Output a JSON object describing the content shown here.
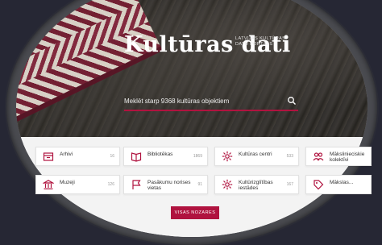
{
  "header": {
    "title": "Kultūras dati",
    "subtitle_line1": "LATVIJAS KULTŪRAS",
    "subtitle_line2": "DATU PORTĀLS"
  },
  "search": {
    "text": "Meklēt starp 9368 kultūras objektiem"
  },
  "categories": [
    {
      "label": "Arhivi",
      "count": "16",
      "icon": "archive-icon"
    },
    {
      "label": "Bibliotēkas",
      "count": "1869",
      "icon": "book-icon"
    },
    {
      "label": "Kultūras centri",
      "count": "533",
      "icon": "gear-flower-icon"
    },
    {
      "label": "Mākslinieciskie kolektīvi",
      "count": "",
      "icon": "people-icon"
    },
    {
      "label": "Muzeji",
      "count": "126",
      "icon": "museum-icon"
    },
    {
      "label": "Pasākumu norises vietas",
      "count": "91",
      "icon": "flag-icon"
    },
    {
      "label": "Kultūrizglītības iestādes",
      "count": "167",
      "icon": "gear-flower-icon"
    },
    {
      "label": "Mākslas...",
      "count": "",
      "icon": "tag-icon"
    }
  ],
  "button": {
    "label": "VISAS NOZARES"
  },
  "colors": {
    "accent": "#b0133f",
    "background": "#262734"
  }
}
